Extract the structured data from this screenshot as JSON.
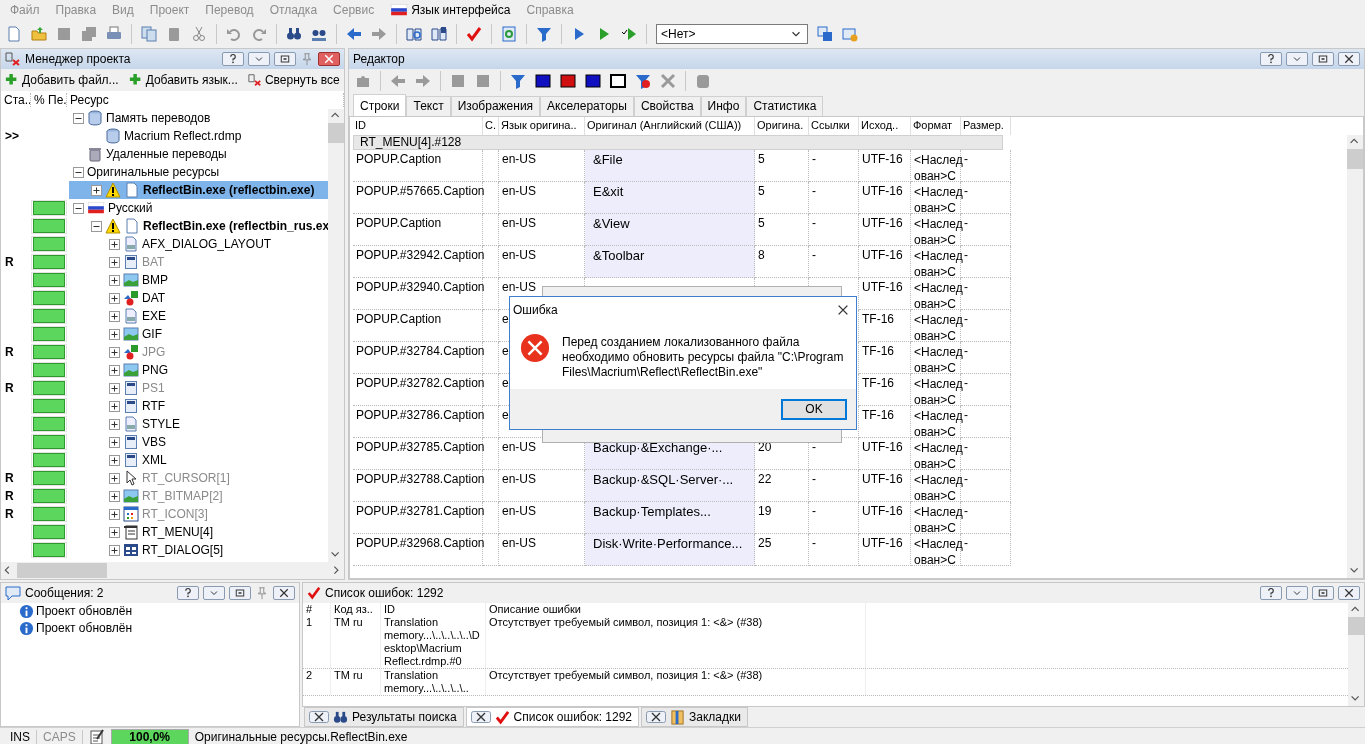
{
  "menu": [
    {
      "label": "Файл",
      "disabled": true,
      "kind": "plain"
    },
    {
      "label": "Правка",
      "disabled": true,
      "kind": "plain"
    },
    {
      "label": "Вид",
      "disabled": true,
      "kind": "plain"
    },
    {
      "label": "Проект",
      "disabled": true,
      "kind": "plain"
    },
    {
      "label": "Перевод",
      "disabled": true,
      "kind": "plain"
    },
    {
      "label": "Отладка",
      "disabled": true,
      "kind": "plain"
    },
    {
      "label": "Сервис",
      "disabled": true,
      "kind": "plain"
    },
    {
      "label": "Язык интерфейса",
      "disabled": false,
      "kind": "language"
    },
    {
      "label": "Справка",
      "disabled": true,
      "kind": "plain"
    }
  ],
  "toolbar": {
    "profile_select": {
      "value": "<Нет>"
    }
  },
  "project_manager": {
    "title": "Менеджер проекта",
    "actions": [
      "Добавить файл...",
      "Добавить язык...",
      "Свернуть все"
    ],
    "columns": [
      "Ста..",
      "% Пе.",
      "Ресурс"
    ],
    "tree": [
      {
        "label": "Память переводов",
        "kind": "tm",
        "expanded": true,
        "selected": false,
        "children": [
          {
            "label": "Macrium Reflect.rdmp",
            "kind": "tm-file",
            "status": ">>",
            "selected": false
          }
        ]
      },
      {
        "label": "Удаленные переводы",
        "kind": "trash",
        "selected": false
      },
      {
        "label": "Оригинальные ресурсы",
        "kind": "group",
        "expanded": true,
        "selected": false,
        "children": [
          {
            "label": "ReflectBin.exe (reflectbin.exe)",
            "kind": "module",
            "expanded": false,
            "selected": true
          }
        ]
      },
      {
        "label": "Русский",
        "kind": "language",
        "expanded": true,
        "selected": false,
        "level": 1,
        "children": [
          {
            "label": "ReflectBin.exe (reflectbin_rus.ex",
            "kind": "module",
            "expanded": true,
            "selected": false,
            "level": 1,
            "children": [
              {
                "label": "AFX_DIALOG_LAYOUT",
                "kind": "binary",
                "expanded": false,
                "selected": false,
                "dimmed": false,
                "level": 1
              },
              {
                "label": "BAT",
                "kind": "script",
                "expanded": false,
                "selected": false,
                "dimmed": true,
                "status": "R",
                "level": 1
              },
              {
                "label": "BMP",
                "kind": "image",
                "expanded": false,
                "selected": false,
                "dimmed": false,
                "level": 1
              },
              {
                "label": "DAT",
                "kind": "shapes",
                "expanded": false,
                "selected": false,
                "dimmed": false,
                "level": 1
              },
              {
                "label": "EXE",
                "kind": "binary",
                "expanded": false,
                "selected": false,
                "dimmed": false,
                "level": 1
              },
              {
                "label": "GIF",
                "kind": "image",
                "expanded": false,
                "selected": false,
                "dimmed": false,
                "level": 1
              },
              {
                "label": "JPG",
                "kind": "shapes",
                "expanded": false,
                "selected": false,
                "dimmed": true,
                "status": "R",
                "level": 1
              },
              {
                "label": "PNG",
                "kind": "image",
                "expanded": false,
                "selected": false,
                "dimmed": false,
                "level": 1
              },
              {
                "label": "PS1",
                "kind": "script",
                "expanded": false,
                "selected": false,
                "dimmed": true,
                "status": "R",
                "level": 1
              },
              {
                "label": "RTF",
                "kind": "script",
                "expanded": false,
                "selected": false,
                "dimmed": false,
                "level": 1
              },
              {
                "label": "STYLE",
                "kind": "binary",
                "expanded": false,
                "selected": false,
                "dimmed": false,
                "level": 1
              },
              {
                "label": "VBS",
                "kind": "script",
                "expanded": false,
                "selected": false,
                "dimmed": false,
                "level": 1
              },
              {
                "label": "XML",
                "kind": "script",
                "expanded": false,
                "selected": false,
                "dimmed": false,
                "level": 1
              },
              {
                "label": "RT_CURSOR[1]",
                "kind": "cursor",
                "expanded": false,
                "selected": false,
                "dimmed": true,
                "status": "R",
                "level": 1
              },
              {
                "label": "RT_BITMAP[2]",
                "kind": "image",
                "expanded": false,
                "selected": false,
                "dimmed": true,
                "status": "R",
                "level": 1
              },
              {
                "label": "RT_ICON[3]",
                "kind": "icon-grid",
                "expanded": false,
                "selected": false,
                "dimmed": true,
                "status": "R",
                "level": 1
              },
              {
                "label": "RT_MENU[4]",
                "kind": "menu",
                "expanded": false,
                "selected": false,
                "dimmed": false,
                "level": 1
              },
              {
                "label": "RT_DIALOG[5]",
                "kind": "dialog",
                "expanded": false,
                "selected": false,
                "dimmed": false,
                "level": 1
              }
            ]
          }
        ]
      }
    ]
  },
  "editor": {
    "title": "Редактор",
    "tabs": [
      {
        "label": "Строки",
        "selected": true
      },
      {
        "label": "Текст",
        "selected": false
      },
      {
        "label": "Изображения",
        "selected": false
      },
      {
        "label": "Акселераторы",
        "selected": false
      },
      {
        "label": "Свойства",
        "selected": false
      },
      {
        "label": "Инфо",
        "selected": false
      },
      {
        "label": "Статистика",
        "selected": false
      }
    ],
    "table": {
      "columns": [
        "ID",
        "С.",
        "Язык оригина..",
        "Оригинал (Английский (США))",
        "Оригина.",
        "Ссылки",
        "Исход..",
        "Формат",
        "Размер."
      ],
      "group": "RT_MENU[4].#128",
      "rows": [
        {
          "id": "POPUP.Caption",
          "lang": "en-US",
          "original": "&File",
          "length": "5",
          "links": "-",
          "encoding": "UTF-16",
          "format": "<Наслед ован>С",
          "size": "-"
        },
        {
          "id": "POPUP.#57665.Caption",
          "lang": "en-US",
          "original": "E&xit",
          "length": "5",
          "links": "-",
          "encoding": "UTF-16",
          "format": "<Наслед ован>С",
          "size": "-"
        },
        {
          "id": "POPUP.Caption",
          "lang": "en-US",
          "original": "&View",
          "length": "5",
          "links": "-",
          "encoding": "UTF-16",
          "format": "<Наслед ован>С",
          "size": "-"
        },
        {
          "id": "POPUP.#32942.Caption",
          "lang": "en-US",
          "original": "&Toolbar",
          "length": "8",
          "links": "-",
          "encoding": "UTF-16",
          "format": "<Наслед ован>С",
          "size": "-"
        },
        {
          "id": "POPUP.#32940.Caption",
          "lang": "en-US",
          "encoding": "UTF-16",
          "format": "<Наслед ован>С",
          "size": "-"
        },
        {
          "id": "POPUP.Caption",
          "lang": "e",
          "encoding": "TF-16",
          "format": "<Наслед ован>С",
          "size": "-"
        },
        {
          "id": "POPUP.#32784.Caption",
          "lang": "e",
          "encoding": "TF-16",
          "format": "<Наслед ован>С",
          "size": "-"
        },
        {
          "id": "POPUP.#32782.Caption",
          "lang": "e",
          "encoding": "TF-16",
          "format": "<Наслед ован>С",
          "size": "-"
        },
        {
          "id": "POPUP.#32786.Caption",
          "lang": "e",
          "encoding": "TF-16",
          "format": "<Наслед ован>С",
          "size": "-"
        },
        {
          "id": "POPUP.#32785.Caption",
          "lang": "en-US",
          "original": "Backup·&Exchange·...",
          "length": "20",
          "links": "-",
          "encoding": "UTF-16",
          "format": "<Наслед ован>С",
          "size": "-"
        },
        {
          "id": "POPUP.#32788.Caption",
          "lang": "en-US",
          "original": "Backup·&SQL·Server·...",
          "length": "22",
          "links": "-",
          "encoding": "UTF-16",
          "format": "<Наслед ован>С",
          "size": "-"
        },
        {
          "id": "POPUP.#32781.Caption",
          "lang": "en-US",
          "original": "Backup·Templates...",
          "length": "19",
          "links": "-",
          "encoding": "UTF-16",
          "format": "<Наслед ован>С",
          "size": "-"
        },
        {
          "id": "POPUP.#32968.Caption",
          "lang": "en-US",
          "original": "Disk·Write·Performance...",
          "length": "25",
          "links": "-",
          "encoding": "UTF-16",
          "format": "<Наслед ован>С",
          "size": "-"
        }
      ]
    }
  },
  "dialog": {
    "title": "Ошибка",
    "message": "Перед созданием локализованного файла необходимо обновить ресурсы файла \"C:\\Program Files\\Macrium\\Reflect\\ReflectBin.exe\"",
    "buttons": [
      "OK"
    ]
  },
  "messages": {
    "title": "Сообщения: 2",
    "items": [
      "Проект обновлён",
      "Проект обновлён"
    ]
  },
  "errors": {
    "title": "Список ошибок: 1292",
    "columns": [
      "#",
      "Код яз..",
      "ID",
      "Описание ошибки"
    ],
    "rows": [
      {
        "num": "1",
        "code": "TM ru",
        "id": "Translation memory...\\..\\..\\..\\..\\Desktop\\Macrium Reflect.rdmp.#0",
        "description": "Отсутствует требуемый символ, позиция 1: <&> (#38)"
      },
      {
        "num": "2",
        "code": "TM ru",
        "id": "Translation memory...\\..\\..\\..\\..",
        "description": "Отсутствует требуемый символ, позиция 1: <&> (#38)"
      }
    ]
  },
  "bottom_tabs": [
    {
      "label": "Результаты поиска",
      "kind": "search",
      "selected": false
    },
    {
      "label": "Список ошибок: 1292",
      "kind": "errors",
      "selected": true
    },
    {
      "label": "Закладки",
      "kind": "bookmarks",
      "selected": false
    }
  ],
  "status_bar": {
    "indicators": [
      {
        "label": "INS",
        "on": true
      },
      {
        "label": "CAPS",
        "on": false
      }
    ],
    "progress": {
      "level": 1,
      "reading": "100,0%"
    },
    "path": "Оригинальные ресурсы.ReflectBin.exe"
  }
}
